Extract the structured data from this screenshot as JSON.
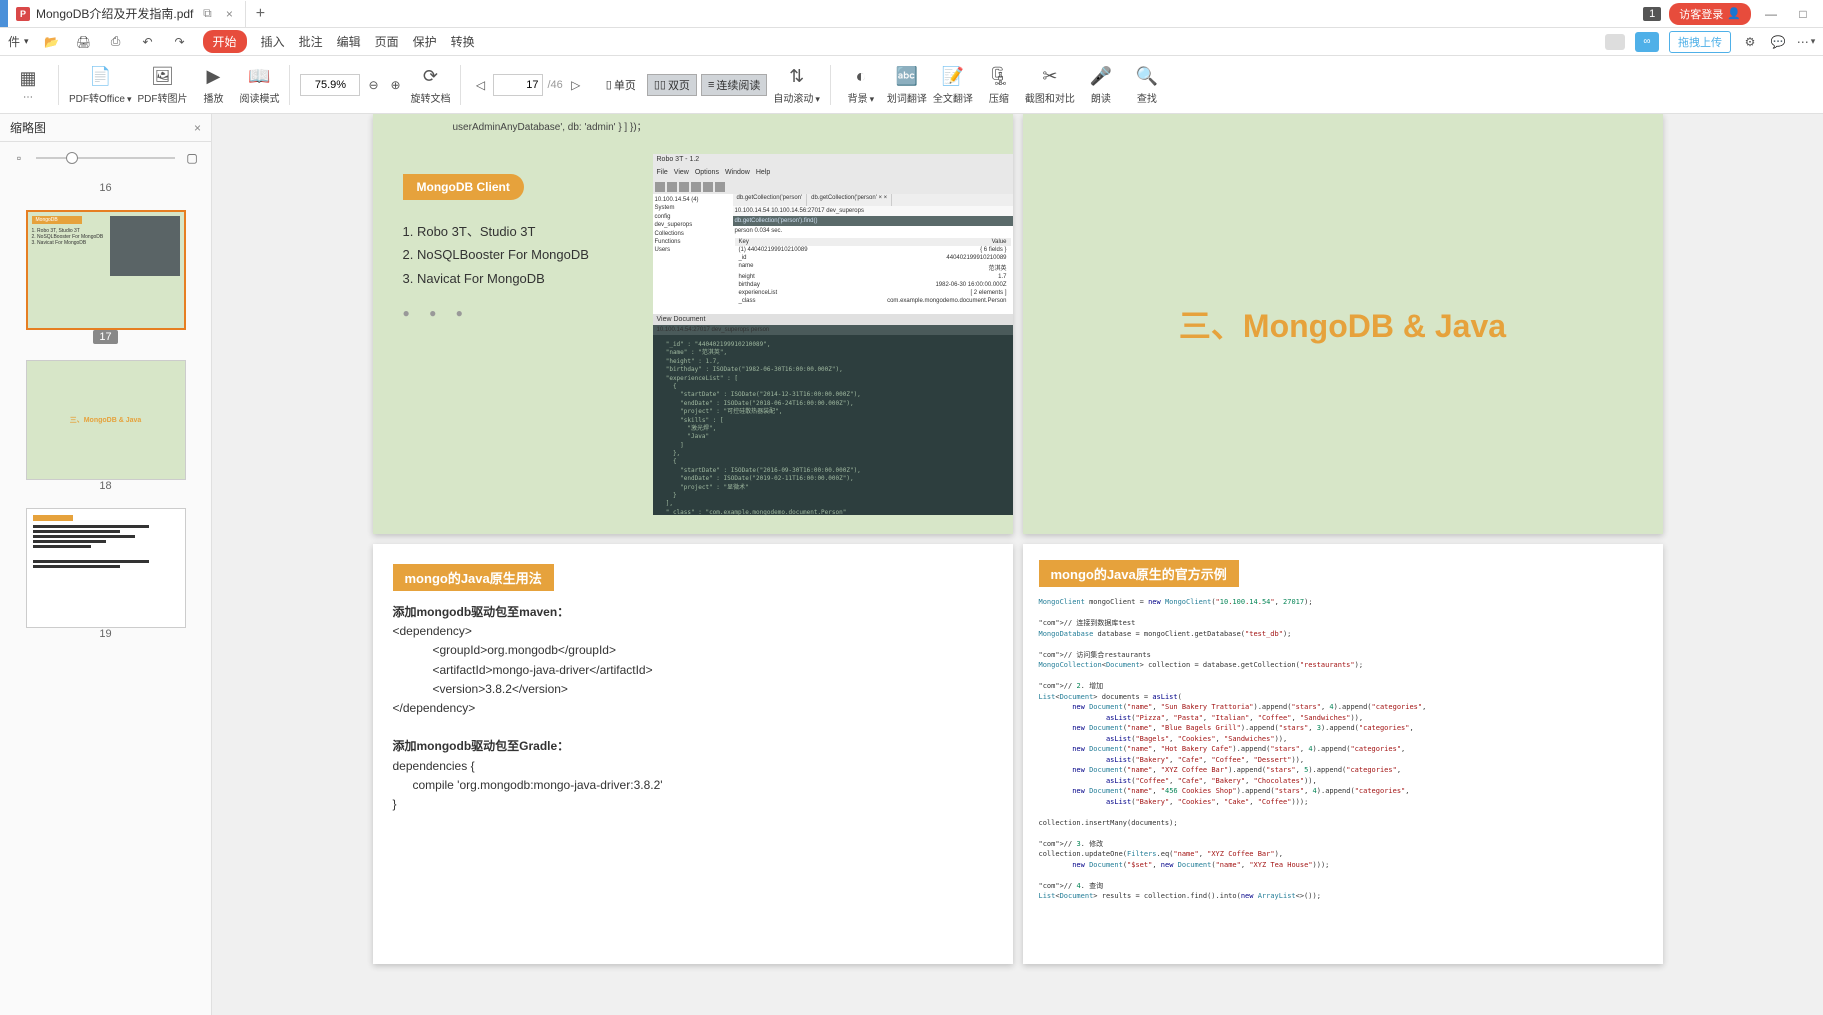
{
  "titlebar": {
    "tab_name": "MongoDB介绍及开发指南.pdf",
    "badge": "1",
    "login": "访客登录"
  },
  "menubar": {
    "file": "件",
    "start": "开始",
    "insert": "插入",
    "annotate": "批注",
    "edit": "编辑",
    "page": "页面",
    "protect": "保护",
    "convert": "转换",
    "upload": "拖拽上传"
  },
  "toolbar": {
    "pdf_to_office": "PDF转Office",
    "pdf_to_image": "PDF转图片",
    "play": "播放",
    "read_mode": "阅读模式",
    "zoom": "75.9%",
    "rotate": "旋转文档",
    "single_page": "单页",
    "double_page": "双页",
    "continuous": "连续阅读",
    "auto_scroll": "自动滚动",
    "current_page": "17",
    "total_pages": "/46",
    "background": "背景",
    "word_translate": "划词翻译",
    "full_translate": "全文翻译",
    "compress": "压缩",
    "screenshot": "截图和对比",
    "read_aloud": "朗读",
    "find": "查找"
  },
  "sidebar": {
    "title": "缩略图",
    "thumbs": [
      {
        "num": "16"
      },
      {
        "num": "17"
      },
      {
        "num": "18"
      },
      {
        "num": "19"
      }
    ]
  },
  "page17": {
    "code_top": "userAdminAnyDatabase', db: 'admin' } ] })；",
    "heading": "MongoDB Client",
    "item1": "1. Robo 3T、Studio 3T",
    "item2": "2. NoSQLBooster For MongoDB",
    "item3": "3. Navicat For MongoDB",
    "robo": {
      "title": "Robo 3T - 1.2",
      "menu": [
        "File",
        "View",
        "Options",
        "Window",
        "Help"
      ],
      "tree": [
        "10.100.14.54 (4)",
        " System",
        " config",
        " dev_superops",
        "  Collections",
        "  Functions",
        "  Users"
      ],
      "tab1": "db.getCollection('person'",
      "tab2": "db.getCollection('person' × ×",
      "cmd": "db.getCollection('person').find()",
      "host": "10.100.14.54  10.100.14.56:27017  dev_superops",
      "result": "person  0.034 sec.",
      "cols": [
        "Key",
        "Value"
      ],
      "rows": [
        [
          "(1) 440402199910210089",
          "{ 6 fields }"
        ],
        [
          "_id",
          "440402199910210089"
        ],
        [
          "name",
          "范淇英"
        ],
        [
          "height",
          "1.7"
        ],
        [
          "birthday",
          "1982-06-30 16:00:00.000Z"
        ],
        [
          "experienceList",
          "[ 2 elements ]"
        ],
        [
          "_class",
          "com.example.mongodemo.document.Person"
        ]
      ],
      "doc_title": "View Document",
      "doc_host": "10.100.14.54:27017  dev_superops  person",
      "doc_body": "  \"_id\" : \"440402199910210089\",\n  \"name\" : \"范淇英\",\n  \"height\" : 1.7,\n  \"birthday\" : ISODate(\"1982-06-30T16:00:00.000Z\"),\n  \"experienceList\" : [\n    {\n      \"startDate\" : ISODate(\"2014-12-31T16:00:00.000Z\"),\n      \"endDate\" : ISODate(\"2018-06-24T16:00:00.000Z\"),\n      \"project\" : \"可控硅散热器装配\",\n      \"skills\" : [\n        \"激光焊\",\n        \"Java\"\n      ]\n    },\n    {\n      \"startDate\" : ISODate(\"2016-09-30T16:00:00.000Z\"),\n      \"endDate\" : ISODate(\"2019-02-11T16:00:00.000Z\"),\n      \"project\" : \"显微术\"\n    }\n  ],\n  \"_class\" : \"com.example.mongodemo.document.Person\""
    }
  },
  "page18": {
    "title": "三、MongoDB & Java"
  },
  "page19": {
    "heading": "mongo的Java原生用法",
    "maven_title": "添加mongodb驱动包至maven：",
    "maven1": "<dependency>",
    "maven2": "<groupId>org.mongodb</groupId>",
    "maven3": "<artifactId>mongo-java-driver</artifactId>",
    "maven4": "<version>3.8.2</version>",
    "maven5": "</dependency>",
    "gradle_title": "添加mongodb驱动包至Gradle：",
    "gradle1": "dependencies {",
    "gradle2": "compile 'org.mongodb:mongo-java-driver:3.8.2'",
    "gradle3": "}"
  },
  "page20": {
    "heading": "mongo的Java原生的官方示例",
    "code": "MongoClient mongoClient = new MongoClient(\"10.100.14.54\", 27017);\n\n// 连接到数据库test\nMongoDatabase database = mongoClient.getDatabase(\"test_db\");\n\n// 访问集合restaurants\nMongoCollection<Document> collection = database.getCollection(\"restaurants\");\n\n// 2. 增加\nList<Document> documents = asList(\n        new Document(\"name\", \"Sun Bakery Trattoria\").append(\"stars\", 4).append(\"categories\",\n                asList(\"Pizza\", \"Pasta\", \"Italian\", \"Coffee\", \"Sandwiches\")),\n        new Document(\"name\", \"Blue Bagels Grill\").append(\"stars\", 3).append(\"categories\",\n                asList(\"Bagels\", \"Cookies\", \"Sandwiches\")),\n        new Document(\"name\", \"Hot Bakery Cafe\").append(\"stars\", 4).append(\"categories\",\n                asList(\"Bakery\", \"Cafe\", \"Coffee\", \"Dessert\")),\n        new Document(\"name\", \"XYZ Coffee Bar\").append(\"stars\", 5).append(\"categories\",\n                asList(\"Coffee\", \"Cafe\", \"Bakery\", \"Chocolates\")),\n        new Document(\"name\", \"456 Cookies Shop\").append(\"stars\", 4).append(\"categories\",\n                asList(\"Bakery\", \"Cookies\", \"Cake\", \"Coffee\")));\n\ncollection.insertMany(documents);\n\n// 3. 修改\ncollection.updateOne(Filters.eq(\"name\", \"XYZ Coffee Bar\"),\n        new Document(\"$set\", new Document(\"name\", \"XYZ Tea House\")));\n\n// 4. 查询\nList<Document> results = collection.find().into(new ArrayList<>());"
  }
}
